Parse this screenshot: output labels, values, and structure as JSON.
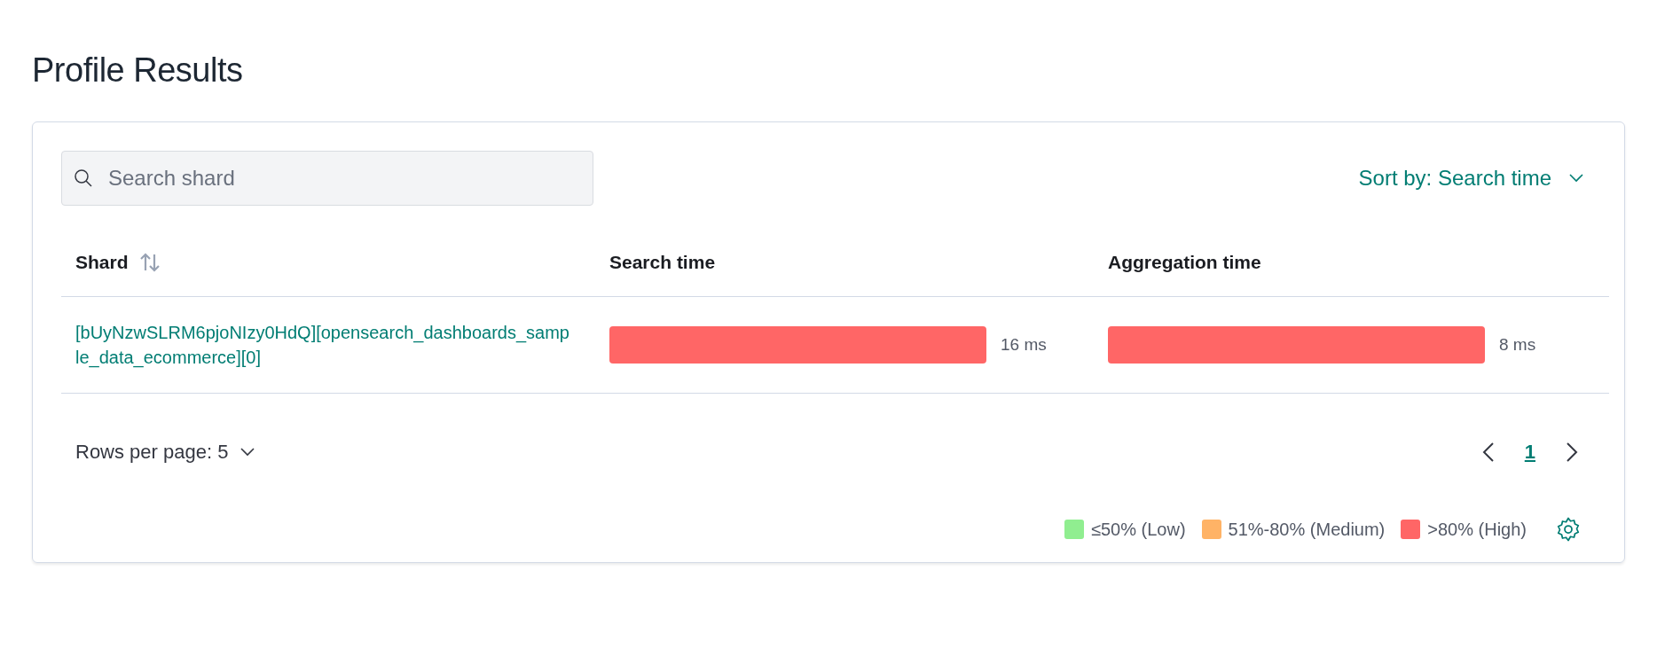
{
  "title": "Profile Results",
  "search": {
    "placeholder": "Search shard"
  },
  "sort": {
    "label": "Sort by: Search time"
  },
  "table": {
    "columns": [
      {
        "label": "Shard",
        "sortable": true
      },
      {
        "label": "Search time",
        "sortable": false
      },
      {
        "label": "Aggregation time",
        "sortable": false
      }
    ],
    "rows": [
      {
        "shard": "[bUyNzwSLRM6pjoNIzy0HdQ][opensearch_dashboards_sample_data_ecommerce][0]",
        "search_time": {
          "color": "#ff6666",
          "reading": "16 ms"
        },
        "aggregation_time": {
          "color": "#ff6666",
          "reading": "8 ms"
        }
      }
    ]
  },
  "pagination": {
    "rows_per_page": "Rows per page: 5",
    "pages": [
      {
        "label": "1",
        "selected": true
      }
    ]
  },
  "legend": [
    {
      "label": "≤50% (Low)",
      "color": "#90ee90"
    },
    {
      "label": "51%-80% (Medium)",
      "color": "#ffb366"
    },
    {
      "label": ">80% (High)",
      "color": "#ff6666"
    }
  ]
}
